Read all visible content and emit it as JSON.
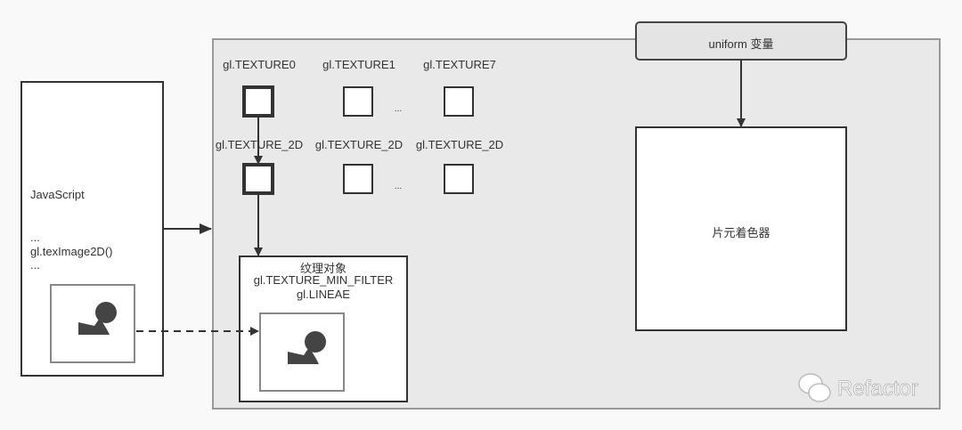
{
  "javascript_box": {
    "title": "JavaScript",
    "lines": [
      "...",
      "gl.texImage2D()",
      "..."
    ]
  },
  "texture_units": {
    "units": [
      "gl.TEXTURE0",
      "gl.TEXTURE1",
      "gl.TEXTURE7"
    ],
    "targets": [
      "gl.TEXTURE_2D",
      "gl.TEXTURE_2D",
      "gl.TEXTURE_2D"
    ],
    "ellipsis": "..."
  },
  "texture_object": {
    "title": "纹理对象",
    "param": "gl.TEXTURE_MIN_FILTER",
    "value": "gl.LINEAE"
  },
  "uniform": {
    "label": "uniform 变量"
  },
  "fragment_shader": {
    "label": "片元着色器"
  },
  "watermark": {
    "text": "Refactor"
  }
}
